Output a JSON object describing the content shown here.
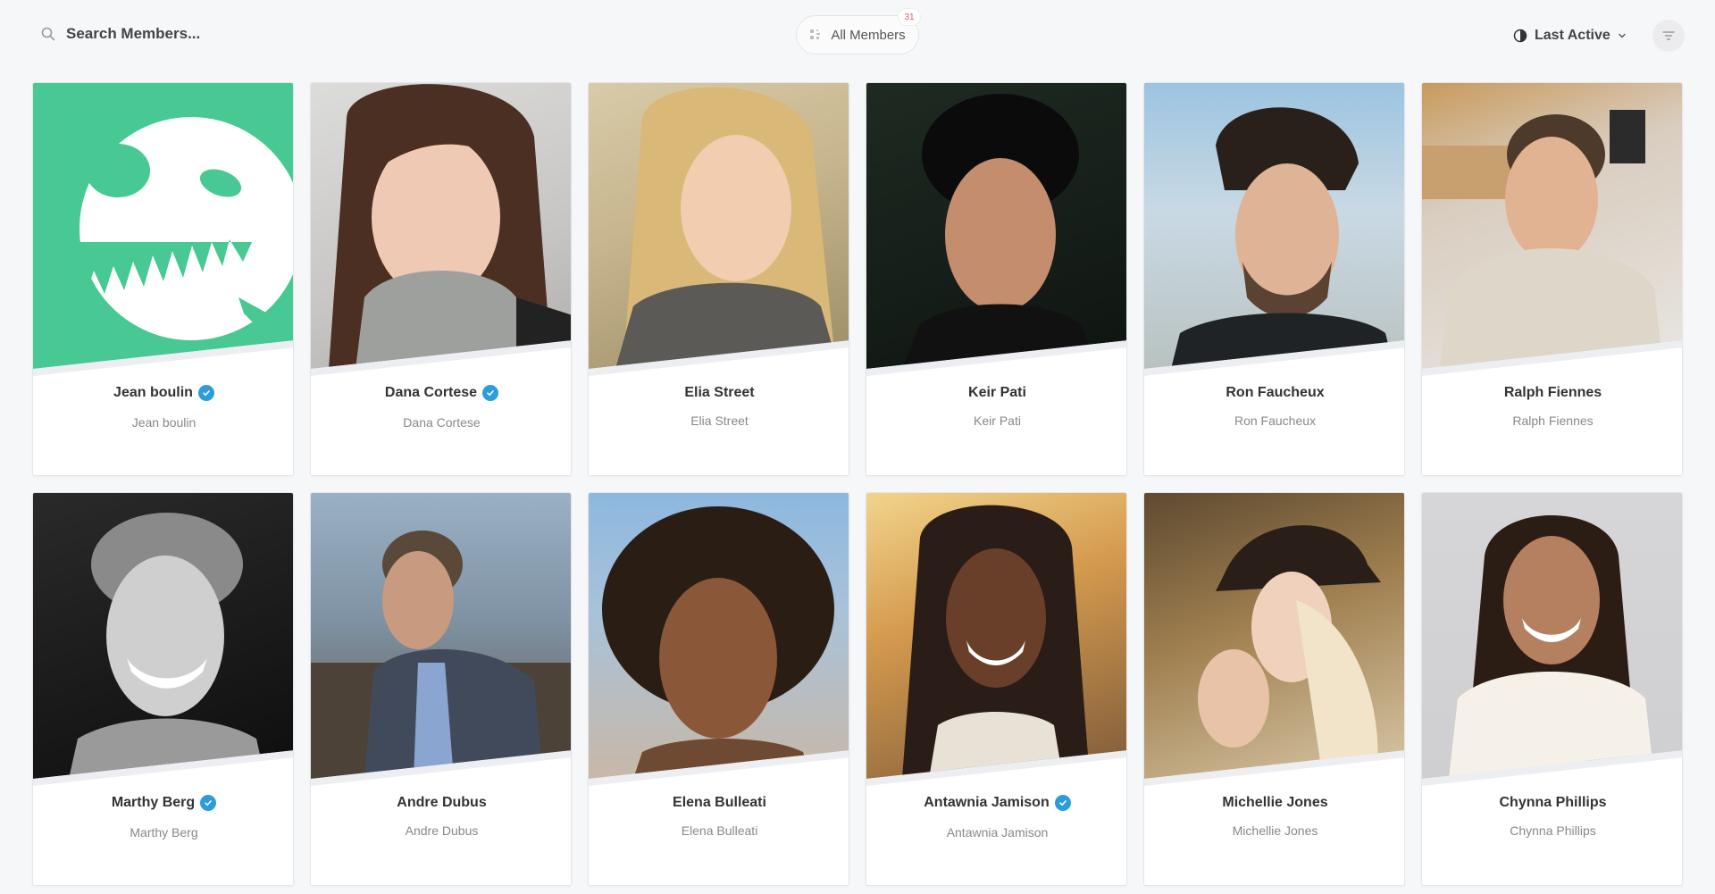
{
  "search": {
    "placeholder": "Search Members..."
  },
  "filter": {
    "label": "All Members",
    "count": "31"
  },
  "sort": {
    "label": "Last Active"
  },
  "members": [
    {
      "name": "Jean boulin",
      "username": "Jean boulin",
      "verified": true
    },
    {
      "name": "Dana Cortese",
      "username": "Dana Cortese",
      "verified": true
    },
    {
      "name": "Elia Street",
      "username": "Elia Street",
      "verified": false
    },
    {
      "name": "Keir Pati",
      "username": "Keir Pati",
      "verified": false
    },
    {
      "name": "Ron Faucheux",
      "username": "Ron Faucheux",
      "verified": false
    },
    {
      "name": "Ralph Fiennes",
      "username": "Ralph Fiennes",
      "verified": false
    },
    {
      "name": "Marthy Berg",
      "username": "Marthy Berg",
      "verified": true
    },
    {
      "name": "Andre Dubus",
      "username": "Andre Dubus",
      "verified": false
    },
    {
      "name": "Elena Bulleati",
      "username": "Elena Bulleati",
      "verified": false
    },
    {
      "name": "Antawnia Jamison",
      "username": "Antawnia Jamison",
      "verified": true
    },
    {
      "name": "Michellie Jones",
      "username": "Michellie Jones",
      "verified": false
    },
    {
      "name": "Chynna Phillips",
      "username": "Chynna Phillips",
      "verified": false
    }
  ],
  "colors": {
    "accent_verified": "#2d9cdb",
    "avatar_green": "#48c893",
    "badge_count": "#e0566b"
  }
}
